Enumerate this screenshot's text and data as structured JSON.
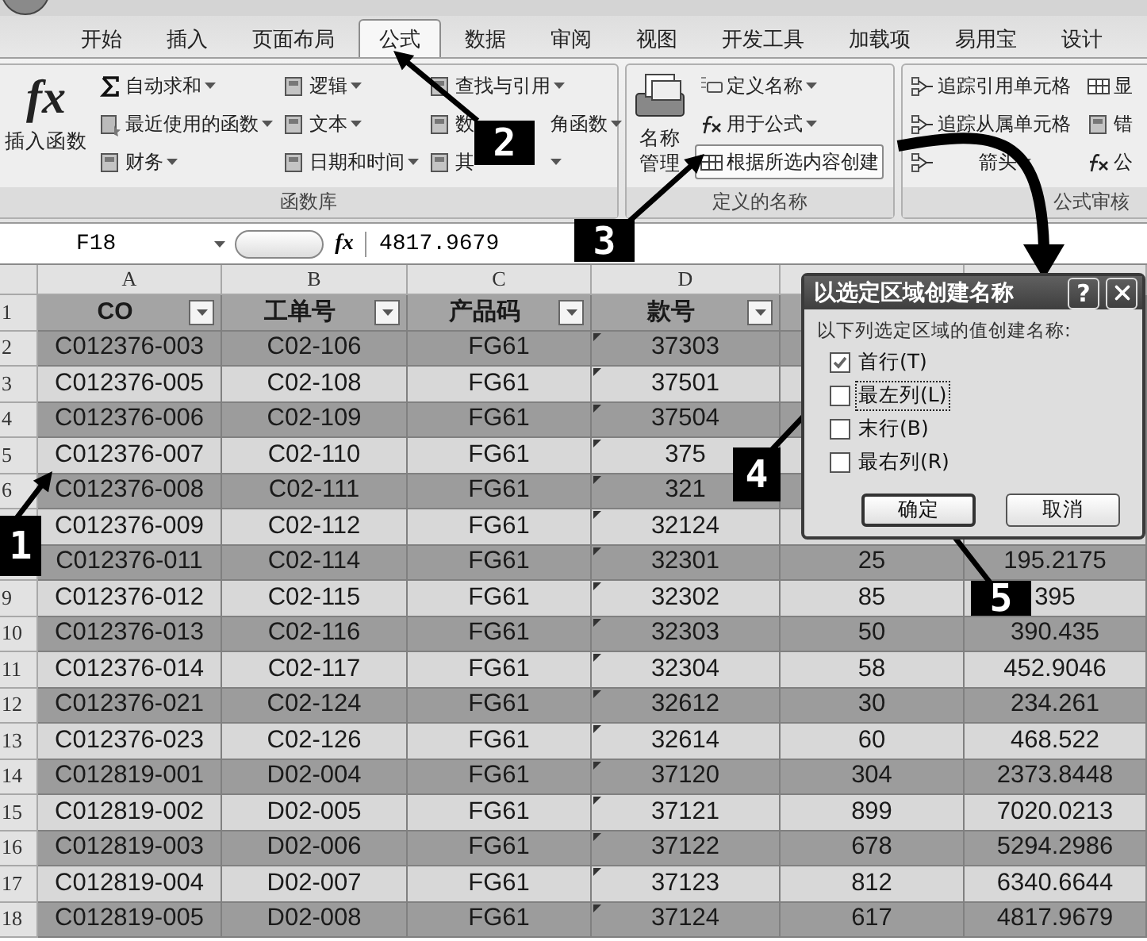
{
  "tabs": [
    {
      "label": "开始",
      "selected": false
    },
    {
      "label": "插入",
      "selected": false
    },
    {
      "label": "页面布局",
      "selected": false
    },
    {
      "label": "公式",
      "selected": true
    },
    {
      "label": "数据",
      "selected": false
    },
    {
      "label": "审阅",
      "selected": false
    },
    {
      "label": "视图",
      "selected": false
    },
    {
      "label": "开发工具",
      "selected": false
    },
    {
      "label": "加载项",
      "selected": false
    },
    {
      "label": "易用宝",
      "selected": false
    },
    {
      "label": "设计",
      "selected": false
    }
  ],
  "ribbon": {
    "groups": [
      {
        "title": "函数库",
        "large": {
          "kind": "function",
          "glyph": "fx",
          "lines": [
            "插入函数"
          ]
        },
        "columns": [
          [
            {
              "label": "自动求和",
              "dropdown": true,
              "highlighted": false
            },
            {
              "label": "最近使用的函数",
              "dropdown": true,
              "highlighted": false
            },
            {
              "label": "财务",
              "dropdown": true,
              "highlighted": false
            }
          ],
          [
            {
              "label": "逻辑",
              "dropdown": true,
              "highlighted": false
            },
            {
              "label": "文本",
              "dropdown": true,
              "highlighted": false
            },
            {
              "label": "日期和时间",
              "dropdown": true,
              "highlighted": false
            }
          ],
          [
            {
              "label": "查找与引用",
              "dropdown": true,
              "highlighted": false
            },
            {
              "label": "数",
              "label_end": "角函数",
              "dropdown": true,
              "highlighted": false
            },
            {
              "label": "其",
              "dropdown": true,
              "highlighted": false
            }
          ]
        ]
      },
      {
        "title": "定义的名称",
        "large": {
          "kind": "names",
          "lines": [
            "名称",
            "管理"
          ]
        },
        "columns": [
          [
            {
              "label": "定义名称",
              "dropdown": true,
              "highlighted": false
            },
            {
              "label": "用于公式",
              "dropdown": true,
              "highlighted": false
            },
            {
              "label": "根据所选内容创建",
              "dropdown": false,
              "highlighted": true
            }
          ]
        ]
      },
      {
        "title": "公式审核",
        "columns": [
          [
            {
              "label": "追踪引用单元格",
              "dropdown": false,
              "highlighted": false
            },
            {
              "label": "追踪从属单元格",
              "dropdown": false,
              "highlighted": false
            },
            {
              "label": "箭头",
              "dropdown": true,
              "highlighted": false
            }
          ],
          [
            {
              "label": "显",
              "dropdown": false,
              "highlighted": false
            },
            {
              "label": "错",
              "dropdown": false,
              "highlighted": false
            },
            {
              "label": "公",
              "dropdown": false,
              "highlighted": false
            }
          ]
        ]
      }
    ]
  },
  "formula_bar": {
    "name_box": "F18",
    "glyph": "fx",
    "value": "4817.9679"
  },
  "sheet": {
    "column_letters": [
      "A",
      "B",
      "C",
      "D"
    ],
    "header": {
      "num": "1",
      "cells": [
        "CO",
        "工单号",
        "产品码",
        "款号"
      ]
    },
    "rows": [
      {
        "num": "2",
        "cells": [
          {
            "text": "C012376-003"
          },
          {
            "text": "C02-106"
          },
          {
            "text": "FG61"
          },
          {
            "text": "37303"
          }
        ]
      },
      {
        "num": "3",
        "cells": [
          {
            "text": "C012376-005"
          },
          {
            "text": "C02-108"
          },
          {
            "text": "FG61"
          },
          {
            "text": "37501"
          }
        ]
      },
      {
        "num": "4",
        "cells": [
          {
            "text": "C012376-006"
          },
          {
            "text": "C02-109"
          },
          {
            "text": "FG61"
          },
          {
            "text": "37504"
          }
        ]
      },
      {
        "num": "5",
        "cells": [
          {
            "text": "C012376-007"
          },
          {
            "text": "C02-110"
          },
          {
            "text": "FG61"
          },
          {
            "text": "375"
          }
        ]
      },
      {
        "num": "6",
        "cells": [
          {
            "text": "C012376-008"
          },
          {
            "text": "C02-111"
          },
          {
            "text": "FG61"
          },
          {
            "text": "321"
          }
        ]
      },
      {
        "cells": [
          {
            "text": "C012376-009"
          },
          {
            "text": "C02-112"
          },
          {
            "text": "FG61"
          },
          {
            "text": "32124"
          }
        ]
      },
      {
        "cells": [
          {
            "text": "C012376-011"
          },
          {
            "text": "C02-114"
          },
          {
            "text": "FG61"
          },
          {
            "text": "32301"
          },
          {
            "text": "25"
          },
          {
            "text": "195.2175"
          }
        ]
      },
      {
        "num": "9",
        "cells": [
          {
            "text": "C012376-012"
          },
          {
            "text": "C02-115"
          },
          {
            "text": "FG61"
          },
          {
            "text": "32302"
          },
          {
            "text": "85"
          },
          {
            "text": "395"
          }
        ]
      },
      {
        "num": "10",
        "cells": [
          {
            "text": "C012376-013"
          },
          {
            "text": "C02-116"
          },
          {
            "text": "FG61"
          },
          {
            "text": "32303"
          },
          {
            "text": "50"
          },
          {
            "text": "390.435"
          }
        ]
      },
      {
        "num": "11",
        "cells": [
          {
            "text": "C012376-014"
          },
          {
            "text": "C02-117"
          },
          {
            "text": "FG61"
          },
          {
            "text": "32304"
          },
          {
            "text": "58"
          },
          {
            "text": "452.9046"
          }
        ]
      },
      {
        "num": "12",
        "cells": [
          {
            "text": "C012376-021"
          },
          {
            "text": "C02-124"
          },
          {
            "text": "FG61"
          },
          {
            "text": "32612"
          },
          {
            "text": "30"
          },
          {
            "text": "234.261"
          }
        ]
      },
      {
        "num": "13",
        "cells": [
          {
            "text": "C012376-023"
          },
          {
            "text": "C02-126"
          },
          {
            "text": "FG61"
          },
          {
            "text": "32614"
          },
          {
            "text": "60"
          },
          {
            "text": "468.522"
          }
        ]
      },
      {
        "num": "14",
        "cells": [
          {
            "text": "C012819-001"
          },
          {
            "text": "D02-004"
          },
          {
            "text": "FG61"
          },
          {
            "text": "37120"
          },
          {
            "text": "304"
          },
          {
            "text": "2373.8448"
          }
        ]
      },
      {
        "num": "15",
        "cells": [
          {
            "text": "C012819-002"
          },
          {
            "text": "D02-005"
          },
          {
            "text": "FG61"
          },
          {
            "text": "37121"
          },
          {
            "text": "899"
          },
          {
            "text": "7020.0213"
          }
        ]
      },
      {
        "num": "16",
        "cells": [
          {
            "text": "C012819-003"
          },
          {
            "text": "D02-006"
          },
          {
            "text": "FG61"
          },
          {
            "text": "37122"
          },
          {
            "text": "678"
          },
          {
            "text": "5294.2986"
          }
        ]
      },
      {
        "num": "17",
        "cells": [
          {
            "text": "C012819-004"
          },
          {
            "text": "D02-007"
          },
          {
            "text": "FG61"
          },
          {
            "text": "37123"
          },
          {
            "text": "812"
          },
          {
            "text": "6340.6644"
          }
        ]
      },
      {
        "num": "18",
        "cells": [
          {
            "text": "C012819-005"
          },
          {
            "text": "D02-008"
          },
          {
            "text": "FG61"
          },
          {
            "text": "37124"
          },
          {
            "text": "617"
          },
          {
            "text": "4817.9679"
          }
        ]
      }
    ]
  },
  "dialog": {
    "title": "以选定区域创建名称",
    "help": "?",
    "prompt": "以下列选定区域的值创建名称:",
    "options": [
      {
        "label": "首行(T)",
        "checked": true,
        "focused": false
      },
      {
        "label": "最左列(L)",
        "checked": false,
        "focused": true
      },
      {
        "label": "末行(B)",
        "checked": false,
        "focused": false
      },
      {
        "label": "最右列(R)",
        "checked": false,
        "focused": false
      }
    ],
    "buttons": [
      {
        "label": "确定",
        "default": true
      },
      {
        "label": "取消",
        "default": false
      }
    ]
  },
  "callouts": [
    {
      "label": "1"
    },
    {
      "label": "2"
    },
    {
      "label": "3"
    },
    {
      "label": "4"
    },
    {
      "label": "5"
    }
  ]
}
